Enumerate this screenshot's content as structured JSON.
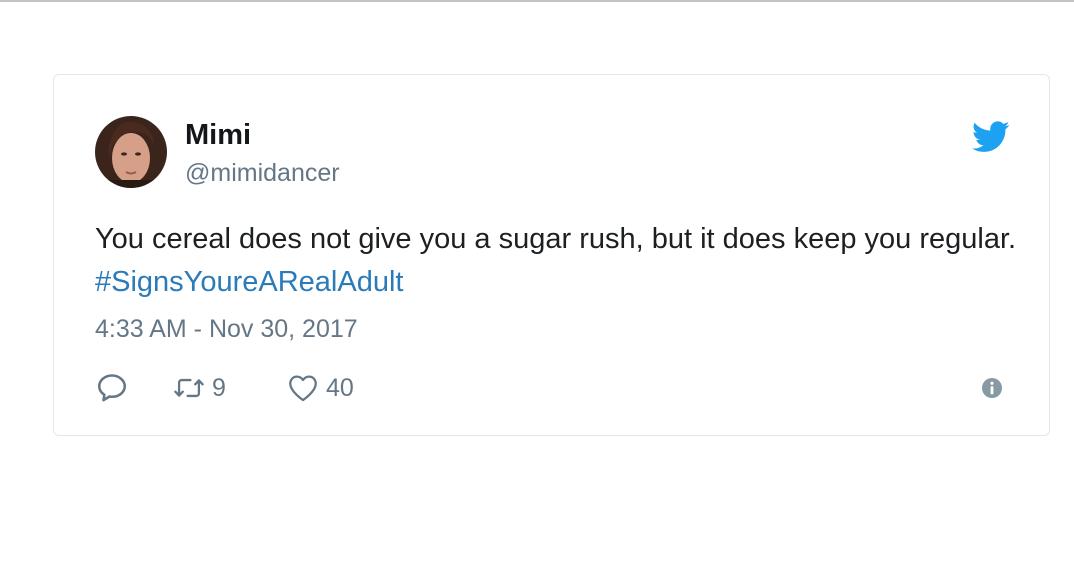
{
  "tweet": {
    "author": {
      "name": "Mimi",
      "handle": "@mimidancer"
    },
    "text": "You cereal does not give you a sugar rush, but it does keep you regular. ",
    "hashtag": "#SignsYoureARealAdult",
    "timestamp": "4:33 AM - Nov 30, 2017",
    "retweet_count": "9",
    "like_count": "40"
  },
  "icons": {
    "brand": "twitter-bird-icon",
    "reply": "reply-icon",
    "retweet": "retweet-icon",
    "like": "heart-icon",
    "info": "info-icon"
  },
  "colors": {
    "brand_blue": "#1da1f2",
    "hashtag": "#2b7bb9",
    "secondary_text": "#657786",
    "primary_text": "#14171a",
    "card_border": "#e1e8ed"
  }
}
